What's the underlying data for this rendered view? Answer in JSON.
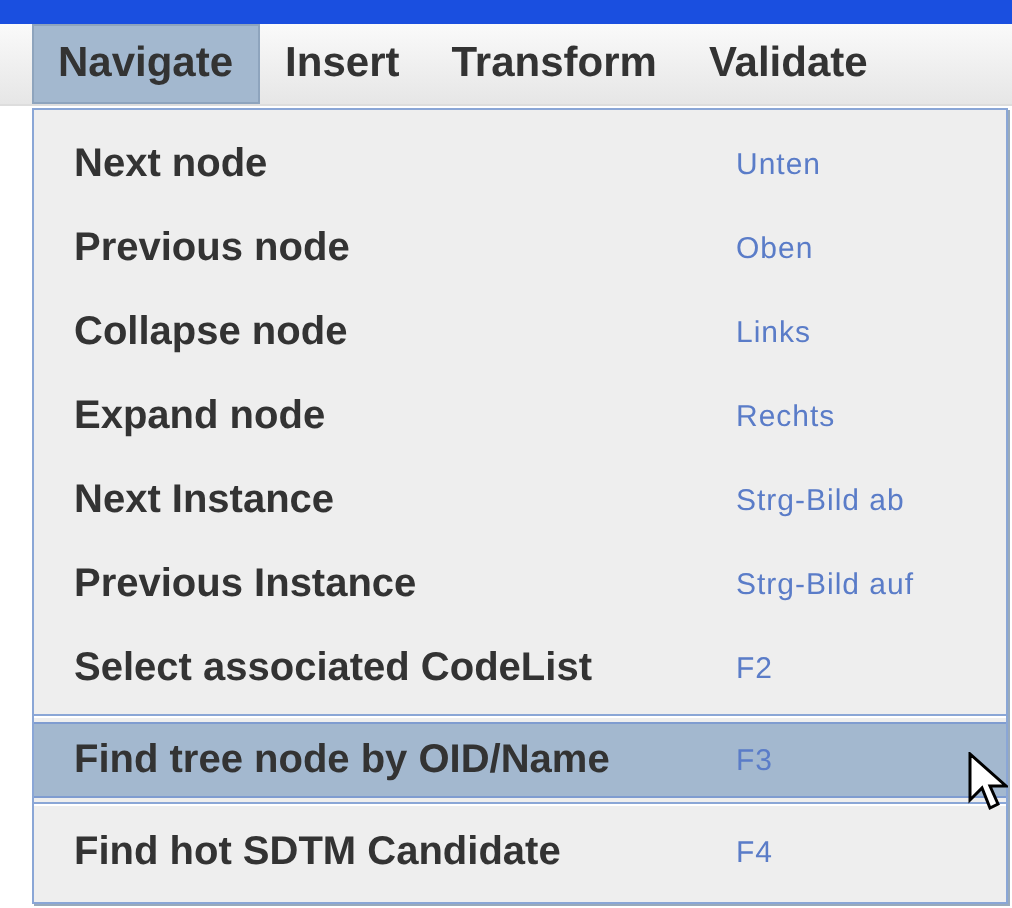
{
  "menubar": [
    {
      "label": "Navigate",
      "selected": true
    },
    {
      "label": "Insert",
      "selected": false
    },
    {
      "label": "Transform",
      "selected": false
    },
    {
      "label": "Validate",
      "selected": false
    }
  ],
  "menu": {
    "items": [
      {
        "kind": "item",
        "label": "Next node",
        "shortcut": "Unten",
        "selected": false
      },
      {
        "kind": "item",
        "label": "Previous node",
        "shortcut": "Oben",
        "selected": false
      },
      {
        "kind": "item",
        "label": "Collapse node",
        "shortcut": "Links",
        "selected": false
      },
      {
        "kind": "item",
        "label": "Expand node",
        "shortcut": "Rechts",
        "selected": false
      },
      {
        "kind": "item",
        "label": "Next Instance",
        "shortcut": "Strg-Bild ab",
        "selected": false
      },
      {
        "kind": "item",
        "label": "Previous Instance",
        "shortcut": "Strg-Bild auf",
        "selected": false
      },
      {
        "kind": "item",
        "label": "Select associated CodeList",
        "shortcut": "F2",
        "selected": false
      },
      {
        "kind": "separator"
      },
      {
        "kind": "item",
        "label": "Find tree node by OID/Name",
        "shortcut": "F3",
        "selected": true
      },
      {
        "kind": "separator"
      },
      {
        "kind": "item",
        "label": "Find hot SDTM Candidate",
        "shortcut": "F4",
        "selected": false
      }
    ]
  }
}
